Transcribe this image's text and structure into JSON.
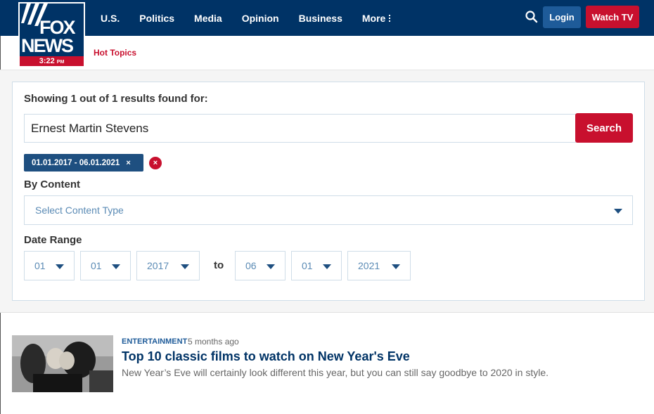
{
  "header": {
    "logo": {
      "line1": "FOX",
      "line2": "NEWS",
      "time": "3:22",
      "ampm": "PM"
    },
    "nav": [
      {
        "label": "U.S."
      },
      {
        "label": "Politics"
      },
      {
        "label": "Media"
      },
      {
        "label": "Opinion"
      },
      {
        "label": "Business"
      },
      {
        "label": "More"
      }
    ],
    "search_icon": "search-icon",
    "login_label": "Login",
    "watch_label": "Watch TV",
    "hot_topics_label": "Hot Topics"
  },
  "search": {
    "showing_text": "Showing 1 out of 1 results found for:",
    "query": "Ernest Martin Stevens",
    "button_label": "Search",
    "active_filter": "01.01.2017 - 06.01.2021",
    "chip_remove": "×",
    "clear_all": "×",
    "by_content_label": "By Content",
    "content_type_placeholder": "Select Content Type",
    "date_range_label": "Date Range",
    "from": {
      "month": "01",
      "day": "01",
      "year": "2017"
    },
    "to_label": "to",
    "to": {
      "month": "06",
      "day": "01",
      "year": "2021"
    }
  },
  "results": [
    {
      "category": "ENTERTAINMENT",
      "age": "5 months ago",
      "title": "Top 10 classic films to watch on New Year's Eve",
      "dek": "New Year’s Eve will certainly look different this year, but you can still say goodbye to 2020 in style."
    }
  ],
  "colors": {
    "brand_navy": "#003366",
    "accent_red": "#c8102e",
    "login_blue": "#1e5b99",
    "chip_blue": "#1e4f80"
  }
}
